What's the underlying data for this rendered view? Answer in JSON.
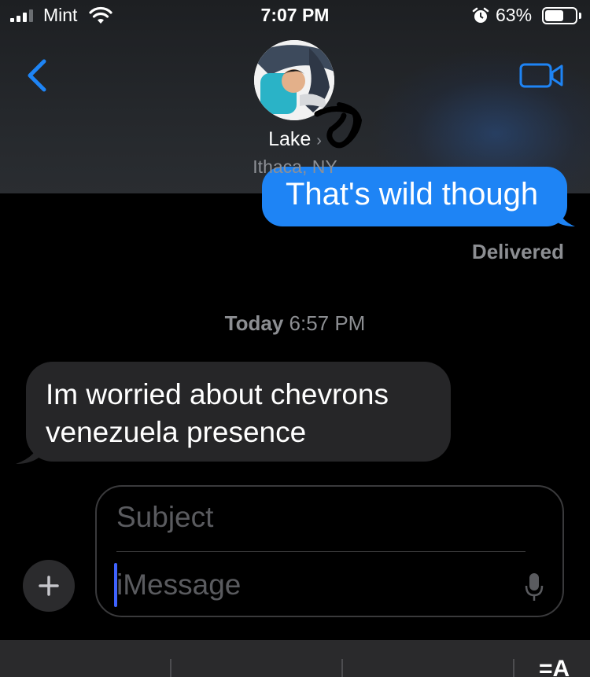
{
  "status_bar": {
    "carrier": "Mint",
    "time": "7:07 PM",
    "battery_percent": "63%",
    "battery_level": 0.63,
    "icons": [
      "signal-icon",
      "wifi-icon",
      "alarm-icon",
      "battery-icon"
    ]
  },
  "header": {
    "contact_name": "Lake",
    "contact_location": "Ithaca, NY",
    "back_icon": "chevron-left-icon",
    "video_icon": "video-camera-icon"
  },
  "conversation": {
    "outgoing_partial_text": "That's wild though",
    "delivered_label": "Delivered",
    "timestamp_day": "Today",
    "timestamp_time": "6:57 PM",
    "incoming_message_line1": "Im worried about chevrons",
    "incoming_message_line2": "venezuela presence"
  },
  "composer": {
    "subject_placeholder": "Subject",
    "message_placeholder": "iMessage",
    "plus_icon": "plus-icon",
    "mic_icon": "microphone-icon"
  },
  "keyboard": {
    "glyph": "=A"
  },
  "colors": {
    "accent": "#1e84f5",
    "bubble_incoming": "#262628",
    "cursor": "#3f63ff",
    "secondary_text": "#8c8e92"
  }
}
